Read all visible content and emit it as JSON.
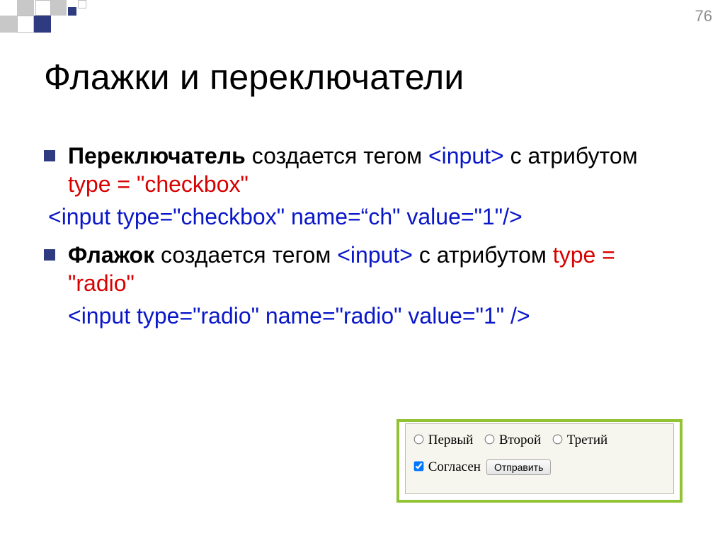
{
  "page_number": "76",
  "title": "Флажки и переключатели",
  "bullet1": {
    "bold": "Переключатель",
    "pre": " создается тегом ",
    "tag": "<input>",
    "post": " с атрибутом ",
    "attr": "type = \"checkbox\""
  },
  "code1": "<input type=\"checkbox\" name=“ch\" value=\"1\"/>",
  "bullet2": {
    "bold": "Флажок",
    "pre": " создается тегом ",
    "tag": "<input>",
    "post": " с атрибутом ",
    "attr": "type = \"radio\""
  },
  "code2": "<input type=\"radio\" name=\"radio\" value=\"1\" />",
  "form": {
    "radio1": "Первый",
    "radio2": "Второй",
    "radio3": "Третий",
    "agree": "Согласен",
    "submit": "Отправить"
  }
}
